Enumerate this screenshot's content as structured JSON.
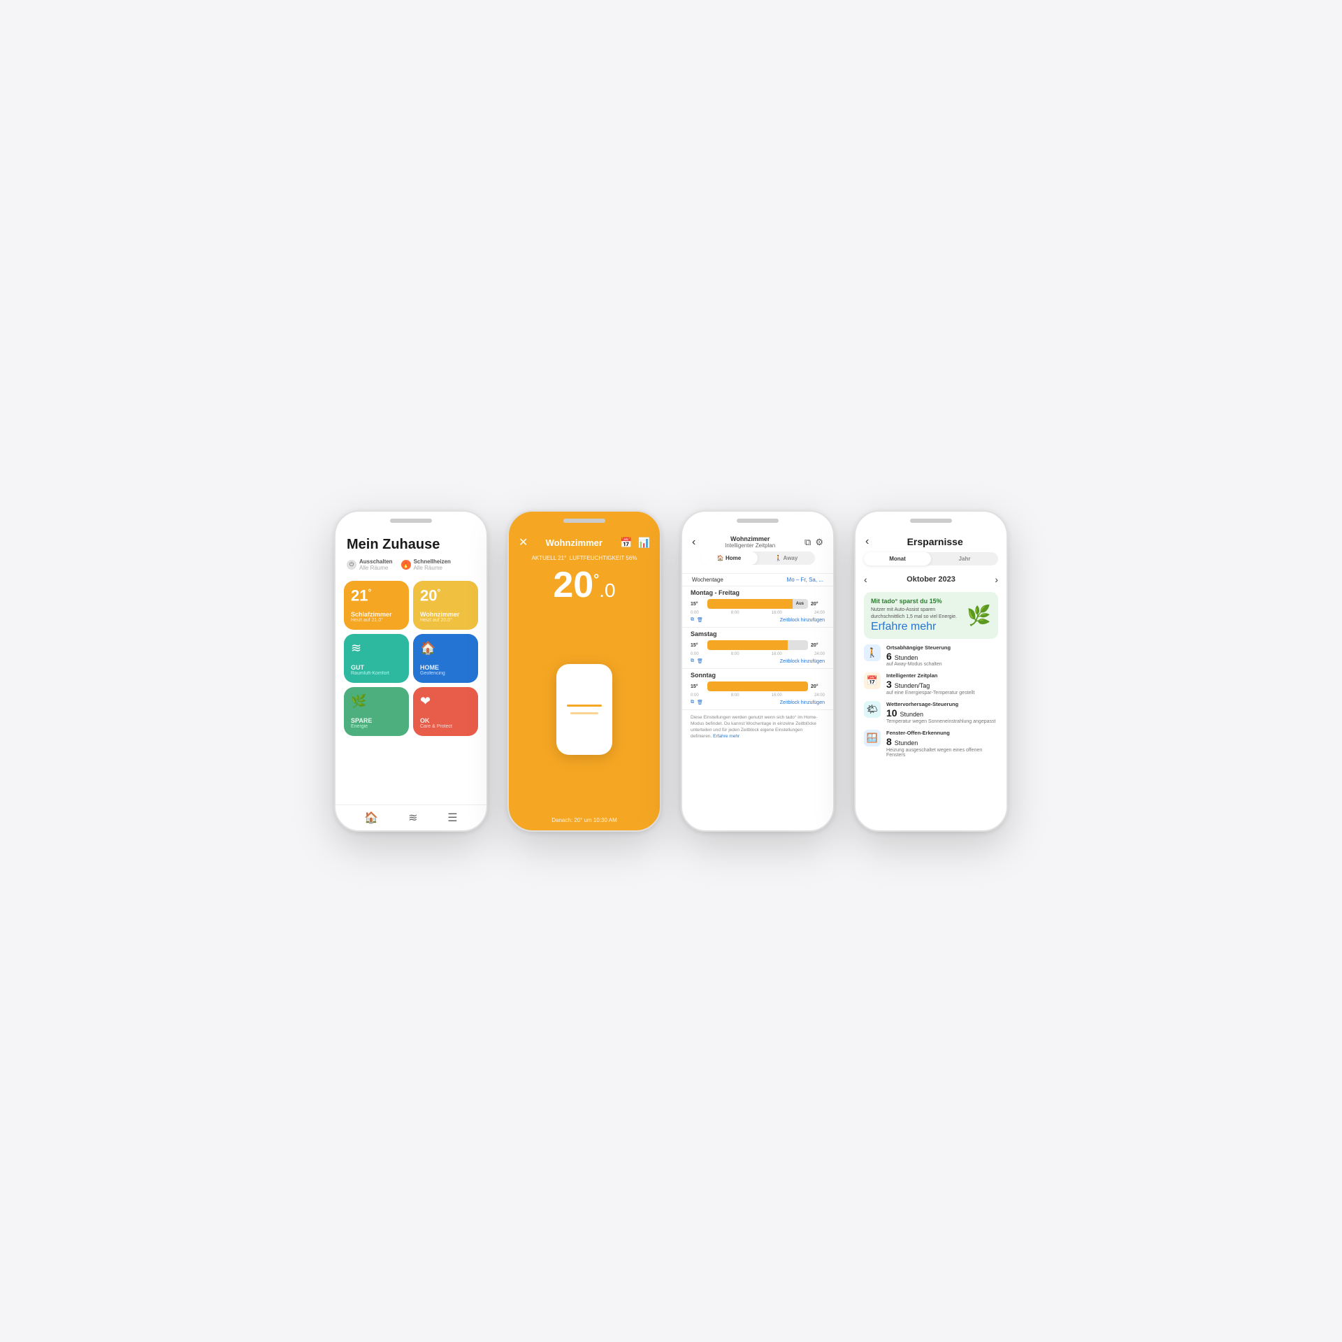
{
  "phones": [
    {
      "id": "phone1",
      "title": "Mein Zuhause",
      "actions": [
        {
          "label": "Ausschalten",
          "sublabel": "Alle Räume",
          "type": "off"
        },
        {
          "label": "Schnellheizen",
          "sublabel": "Alle Räume",
          "type": "heat"
        }
      ],
      "tiles": [
        {
          "type": "temp",
          "value": "21",
          "label": "Schlafzimmer",
          "sublabel": "Heizt auf 21.0°",
          "color": "orange"
        },
        {
          "type": "temp",
          "value": "20",
          "label": "Wohnzimmer",
          "sublabel": "Heizt auf 20.0°",
          "color": "amber"
        },
        {
          "type": "icon",
          "icon": "≋",
          "label": "GUT",
          "sublabel": "Raumluft-Komfort",
          "color": "teal"
        },
        {
          "type": "icon",
          "icon": "🏠",
          "label": "HOME",
          "sublabel": "Geofencing",
          "color": "blue"
        },
        {
          "type": "icon",
          "icon": "🌿",
          "label": "SPARE",
          "sublabel": "Energie",
          "color": "green"
        },
        {
          "type": "icon",
          "icon": "❤",
          "label": "OK",
          "sublabel": "Care & Protect",
          "color": "red"
        }
      ],
      "nav": [
        "🏠",
        "≋",
        "☰"
      ]
    },
    {
      "id": "phone2",
      "room": "Wohnzimmer",
      "current_label": "AKTUELL 21°",
      "humidity_label": "LUFTFEUCHTIGKEIT 56%",
      "temperature": "20",
      "unit": "°",
      "fraction": "0",
      "footer": "Danach: 20° um 10:30 AM"
    },
    {
      "id": "phone3",
      "room": "Wohnzimmer",
      "subtitle": "Intelligenter Zeitplan",
      "tabs": [
        {
          "label": "🏠 Home",
          "active": true
        },
        {
          "label": "🚶 Away",
          "active": false
        }
      ],
      "wochentage_label": "Wochentage",
      "wochentage_value": "Mo – Fr, Sa, ...",
      "sections": [
        {
          "title": "Montag - Freitag",
          "segments": [
            {
              "label": "15°",
              "from": 0,
              "to": 55,
              "color": "orange"
            },
            {
              "label": "20°",
              "from": 55,
              "to": 85,
              "color": "orange"
            },
            {
              "label": "Aus",
              "from": 85,
              "to": 100,
              "color": "gray"
            }
          ],
          "times": [
            "0:00",
            "8:00",
            "16:00",
            "24:00"
          ],
          "add_label": "Zeitblock hinzufügen"
        },
        {
          "title": "Samstag",
          "segments": [
            {
              "label": "15°",
              "from": 0,
              "to": 55,
              "color": "orange"
            },
            {
              "label": "20°",
              "from": 55,
              "to": 80,
              "color": "orange"
            },
            {
              "label": "15°",
              "from": 80,
              "to": 100,
              "color": "gray"
            }
          ],
          "times": [
            "0:00",
            "8:00",
            "16:00",
            "24:00"
          ],
          "add_label": "Zeitblock hinzufügen"
        },
        {
          "title": "Sonntag",
          "segments": [
            {
              "label": "15°",
              "from": 0,
              "to": 55,
              "color": "orange"
            },
            {
              "label": "20°",
              "from": 55,
              "to": 100,
              "color": "orange"
            }
          ],
          "times": [
            "0:00",
            "8:00",
            "16:00",
            "24:00"
          ],
          "add_label": "Zeitblock hinzufügen"
        }
      ],
      "footer_text": "Diese Einstellungen werden genutzt wenn sich tado° im Home-Modus befindet. Du kannst Wochentage in einzelne Zeitblöcke unterteilen und für jeden Zeitblock eigene Einstellungen definieren.",
      "footer_link": "Erfahre mehr"
    },
    {
      "id": "phone4",
      "title": "Ersparnisse",
      "tabs": [
        "Monat",
        "Jahr"
      ],
      "active_tab": 0,
      "month": "Oktober 2023",
      "savings_headline": "Mit tado° sparst du 15%",
      "savings_desc": "Nutzer mit Auto-Assist sparen durchschnittlich 1,5 mal so viel Energie.",
      "savings_link": "Erfahre mehr",
      "items": [
        {
          "icon": "🚶",
          "icon_color": "blue",
          "title": "Ortsabhängige Steuerung",
          "hours": "6",
          "unit": "Stunden",
          "desc": "auf Away-Modus schalten"
        },
        {
          "icon": "📅",
          "icon_color": "orange",
          "title": "Intelligenter Zeitplan",
          "hours": "3",
          "unit": "Stunden/Tag",
          "desc": "auf eine Energiespar-Temperatur gestellt"
        },
        {
          "icon": "🌤",
          "icon_color": "teal",
          "title": "Wettervorhersage-Steuerung",
          "hours": "10",
          "unit": "Stunden",
          "desc": "Temperatur wegen Sonneneinstrahlung angepasst"
        },
        {
          "icon": "🪟",
          "icon_color": "blue",
          "title": "Fenster-Offen-Erkennung",
          "hours": "8",
          "unit": "Stunden",
          "desc": "Heizung ausgeschaltet wegen eines offenen Fensters"
        }
      ]
    }
  ]
}
